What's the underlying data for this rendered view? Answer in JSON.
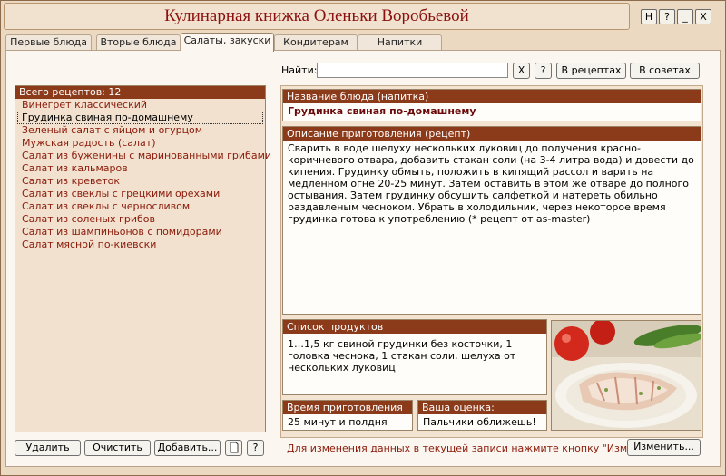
{
  "window": {
    "title": "Кулинарная книжка Оленьки Воробьевой",
    "buttons": [
      "H",
      "?",
      "_",
      "X"
    ]
  },
  "tabs": [
    "Первые блюда",
    "Вторые блюда",
    "Салаты, закуски",
    "Кондитерам",
    "Напитки"
  ],
  "active_tab": "Салаты, закуски",
  "search": {
    "label": "Найти:",
    "value": "",
    "clear_label": "X",
    "help_label": "?",
    "in_recipes_label": "В рецептах",
    "in_tips_label": "В советах"
  },
  "recipe_list": {
    "header": "Всего рецептов: 12",
    "items": [
      "Винегрет классический",
      "Грудинка свиная по-домашнему",
      "Зеленый салат с яйцом и огурцом",
      "Мужская радость (салат)",
      "Салат из буженины с маринованными грибами",
      "Салат из кальмаров",
      "Салат из креветок",
      "Салат из свеклы с грецкими орехами",
      "Салат из свеклы с черносливом",
      "Салат из соленых грибов",
      "Салат из шампиньонов с помидорами",
      "Салат мясной по-киевски"
    ],
    "selected_index": 1
  },
  "left_buttons": {
    "delete": "Удалить",
    "clear": "Очистить",
    "add": "Добавить...",
    "help": "?"
  },
  "details": {
    "name_label": "Название блюда (напитка)",
    "name_value": "Грудинка свиная по-домашнему",
    "description_label": "Описание приготовления (рецепт)",
    "description_value": "Сварить в воде шелуху нескольких луковиц до получения красно-коричневого отвара, добавить стакан соли (на 3-4 литра вода) и довести до кипения. Грудинку обмыть, положить в кипящий рассол и варить на медленном огне 20-25 минут. Затем оставить в этом же отваре до полного остывания. Затем грудинку обсушить салфеткой и натереть обильно раздавленым чесноком. Убрать в холодильник, через некоторое время грудинка готова к употреблению (* рецепт от as-master)",
    "products_label": "Список продуктов",
    "products_value": "1…1,5 кг свиной грудинки без косточки, 1 головка чеснока, 1 стакан соли, шелуха от нескольких луковиц",
    "time_label": "Время приготовления",
    "time_value": "25 минут и полдня",
    "rating_label": "Ваша оценка:",
    "rating_value": "Пальчики оближешь!"
  },
  "hint": "Для изменения данных в текущей записи нажмите кнопку \"Изменить\"",
  "edit_button": "Изменить..."
}
